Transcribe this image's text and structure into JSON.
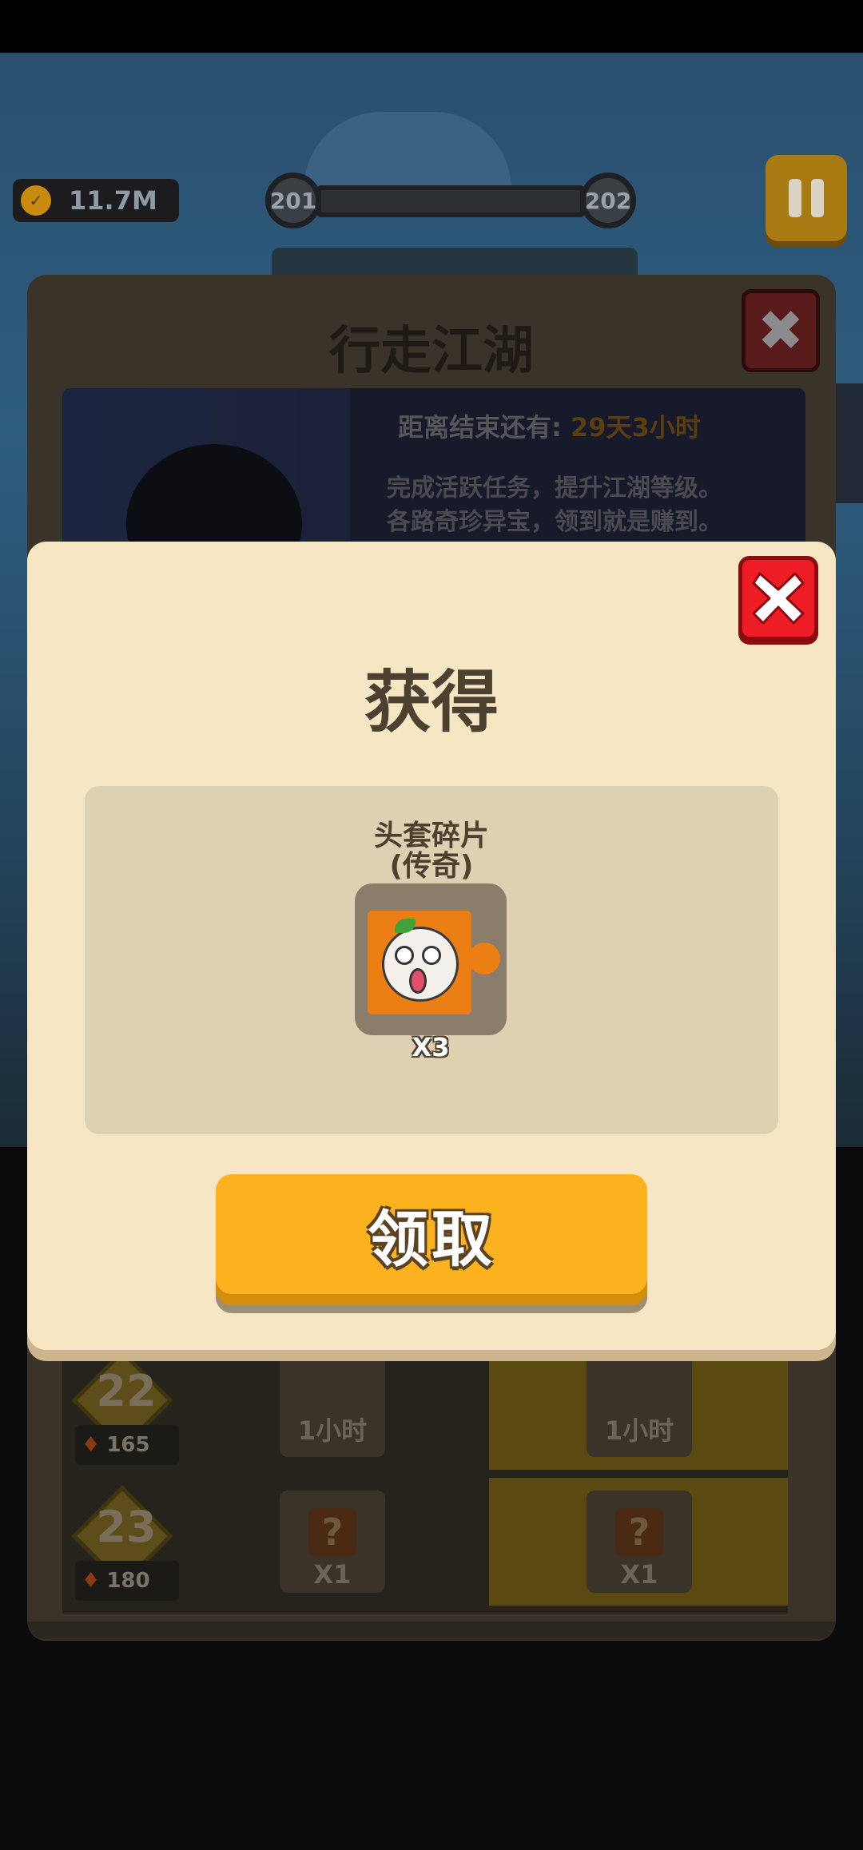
{
  "hud": {
    "coins": "11.7M",
    "level_current": "201",
    "level_next": "202"
  },
  "event_panel": {
    "title": "行走江湖",
    "countdown_label": "距离结束还有:",
    "countdown_value": "29天3小时",
    "description_line1": "完成活跃任务，提升江湖等级。",
    "description_line2": "各路奇珍异宝，领到就是赚到。",
    "close_icon": "close-icon"
  },
  "level_rows": [
    {
      "level": "22",
      "points": "165",
      "free_reward": "1小时",
      "premium_reward": "1小时"
    },
    {
      "level": "23",
      "points": "180",
      "free_reward": "X1",
      "premium_reward": "X1"
    }
  ],
  "reward_modal": {
    "title": "获得",
    "item_name_line1": "头套碎片",
    "item_name_line2": "(传奇)",
    "item_quantity": "X3",
    "claim_button": "领取",
    "close_icon": "close-icon"
  },
  "colors": {
    "modal_bg": "#f7e6c3",
    "claim_button": "#fbb21e",
    "close_button": "#ee1c25",
    "item_orange": "#ec7f14"
  }
}
